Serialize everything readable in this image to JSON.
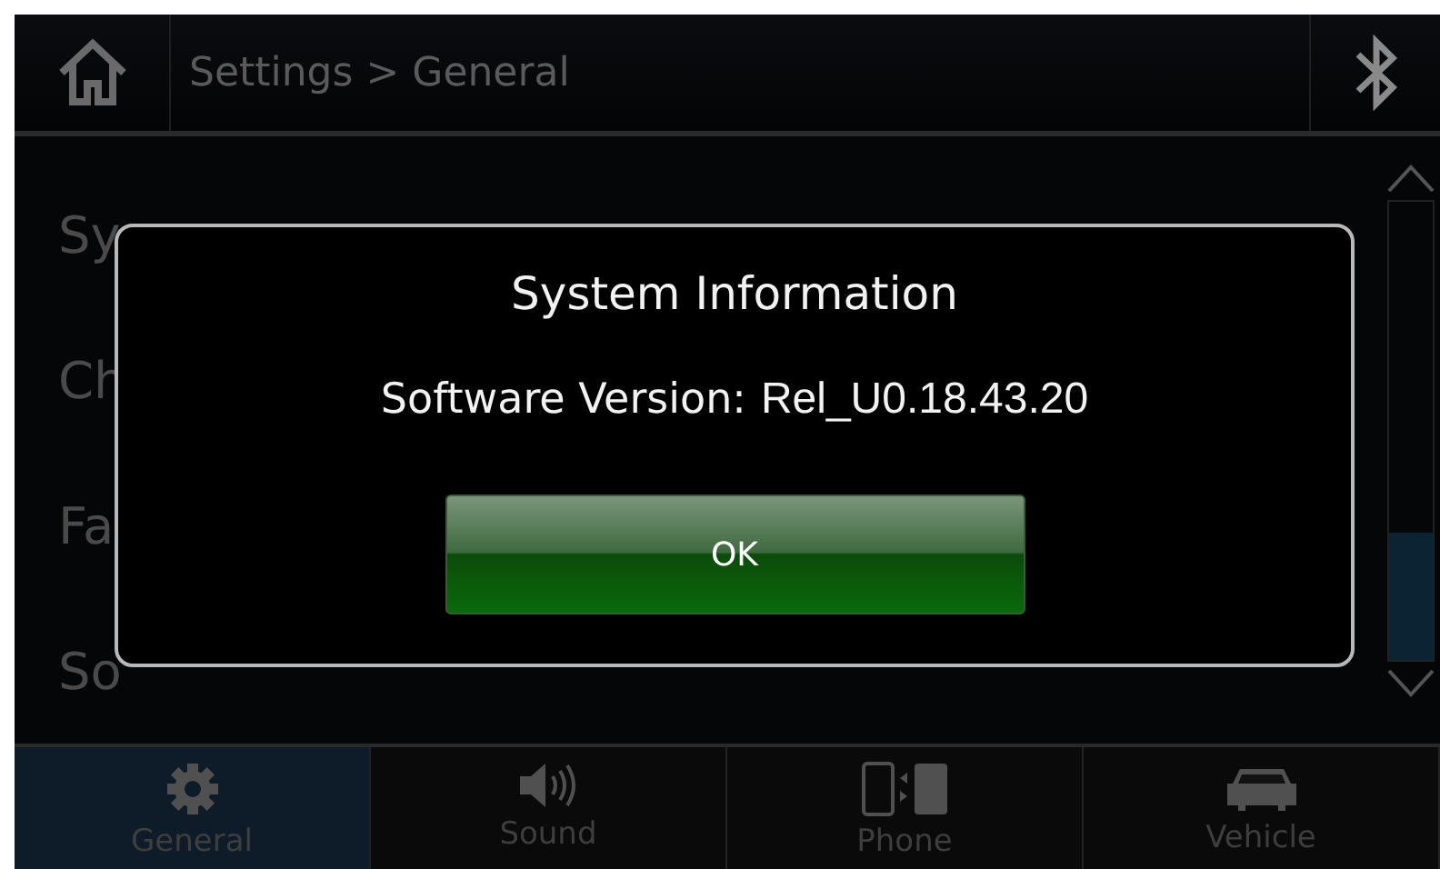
{
  "header": {
    "breadcrumb": "Settings > General"
  },
  "list_items": [
    "Sy",
    "Ch",
    "Fa",
    "So"
  ],
  "dialog": {
    "title": "System Information",
    "label": "Software Version:",
    "value": "Rel_U0.18.43.20",
    "button": "OK"
  },
  "tabs": [
    {
      "label": "General",
      "selected": true
    },
    {
      "label": "Sound",
      "selected": false
    },
    {
      "label": "Phone",
      "selected": false
    },
    {
      "label": "Vehicle",
      "selected": false
    }
  ]
}
